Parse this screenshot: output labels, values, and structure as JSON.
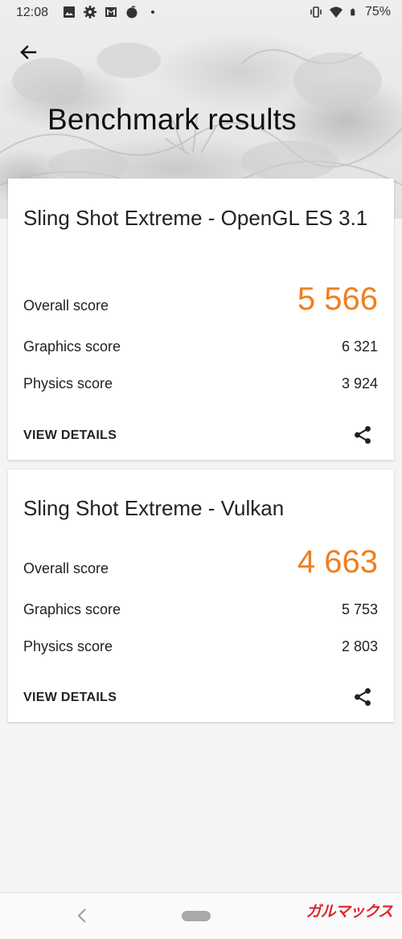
{
  "status_bar": {
    "time": "12:08",
    "battery": "75%",
    "icons_left": [
      "image-icon",
      "gear-icon",
      "gmail-icon",
      "app-icon",
      "dot-icon"
    ],
    "icons_right": [
      "vibrate-icon",
      "wifi-icon",
      "battery-icon"
    ]
  },
  "header": {
    "title": "Benchmark results"
  },
  "results": [
    {
      "title": "Sling Shot Extreme - OpenGL ES 3.1",
      "overall_label": "Overall score",
      "overall_value": "5 566",
      "graphics_label": "Graphics score",
      "graphics_value": "6 321",
      "physics_label": "Physics score",
      "physics_value": "3 924",
      "details_label": "VIEW DETAILS"
    },
    {
      "title": "Sling Shot Extreme - Vulkan",
      "overall_label": "Overall score",
      "overall_value": "4 663",
      "graphics_label": "Graphics score",
      "graphics_value": "5 753",
      "physics_label": "Physics score",
      "physics_value": "2 803",
      "details_label": "VIEW DETAILS"
    }
  ],
  "watermark": "ガルマックス",
  "colors": {
    "accent": "#f07f1f",
    "text": "#212121",
    "background": "#f4f4f4",
    "card": "#ffffff"
  }
}
